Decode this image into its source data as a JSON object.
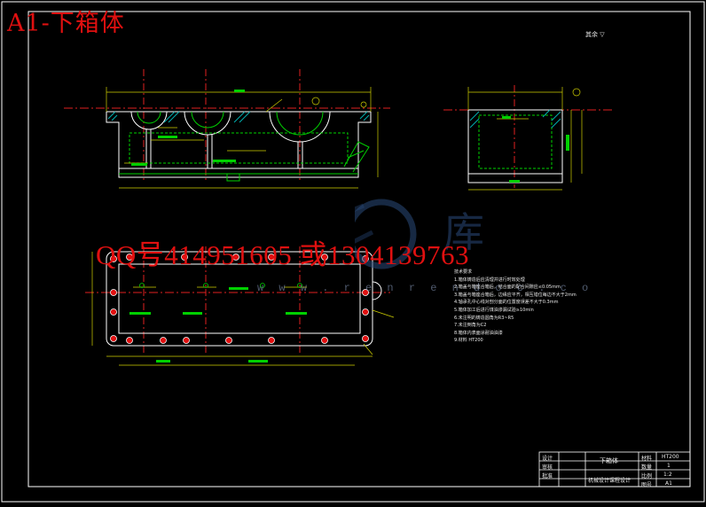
{
  "header": {
    "title": "A1-下箱体"
  },
  "watermark": {
    "contact": "QQ号414951605  或1304139763",
    "url": "w w w . r e n r e n d o c . c o"
  },
  "corner_mark": "其余 ▽",
  "tech_notes": {
    "heading": "技术要求",
    "items": [
      "1.箱体铸造后应清理并进行时效处理",
      "2.箱盖与箱座合箱后，结合面的配合间隙应≤0.05mm",
      "3.箱盖与箱座合箱后，边缘应平齐，相互错位每边不大于2mm",
      "4.轴承孔中心线对剖分面的位置度误差不大于0.3mm",
      "5.箱体加工后进行煤油渗漏试验≥10min",
      "6.未注明的铸造圆角为R3~R5",
      "7.未注倒角为C2",
      "8.箱体内表面涂耐油油漆",
      "9.材料 HT200"
    ]
  },
  "title_block": {
    "part_name": "下箱体",
    "material": "HT200",
    "quantity": "1",
    "scale": "1:2",
    "sheet_size": "A1",
    "row_labels": [
      "材料",
      "数量",
      "比例",
      "图号"
    ],
    "left_rows": [
      "设计",
      "审核",
      "批准"
    ],
    "org": "机械设计课程设计"
  },
  "colors": {
    "background": "#000000",
    "outline": "#ffffff",
    "geometry": "#00d000",
    "centerline": "#e02020",
    "dimension": "#d0d000",
    "hatch": "#00b0b0",
    "accent": "#e01010"
  }
}
